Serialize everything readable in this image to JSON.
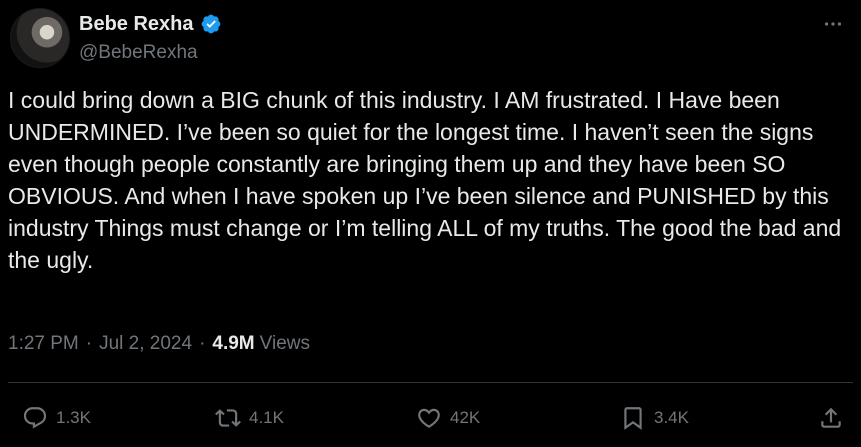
{
  "author": {
    "display_name": "Bebe Rexha",
    "handle": "@BebeRexha",
    "verified_color": "#1d9bf0"
  },
  "tweet": {
    "text": "I could bring down a BIG chunk of this industry. I AM frustrated. I Have been UNDERMINED. I’ve been so quiet for the longest time. I haven’t seen the signs even though people constantly are bringing them up and they have been SO OBVIOUS. And when I have spoken up I’ve been silence and PUNISHED by this industry Things must change or I’m telling ALL of my truths. The good the bad and the ugly."
  },
  "meta": {
    "time": "1:27 PM",
    "date": "Jul 2, 2024",
    "views_count": "4.9M",
    "views_label": "Views"
  },
  "actions": {
    "replies": "1.3K",
    "reposts": "4.1K",
    "likes": "42K",
    "bookmarks": "3.4K"
  },
  "icons": [
    "avatar",
    "verified-badge-icon",
    "more-icon",
    "reply-icon",
    "repost-icon",
    "like-icon",
    "bookmark-icon",
    "share-icon"
  ]
}
